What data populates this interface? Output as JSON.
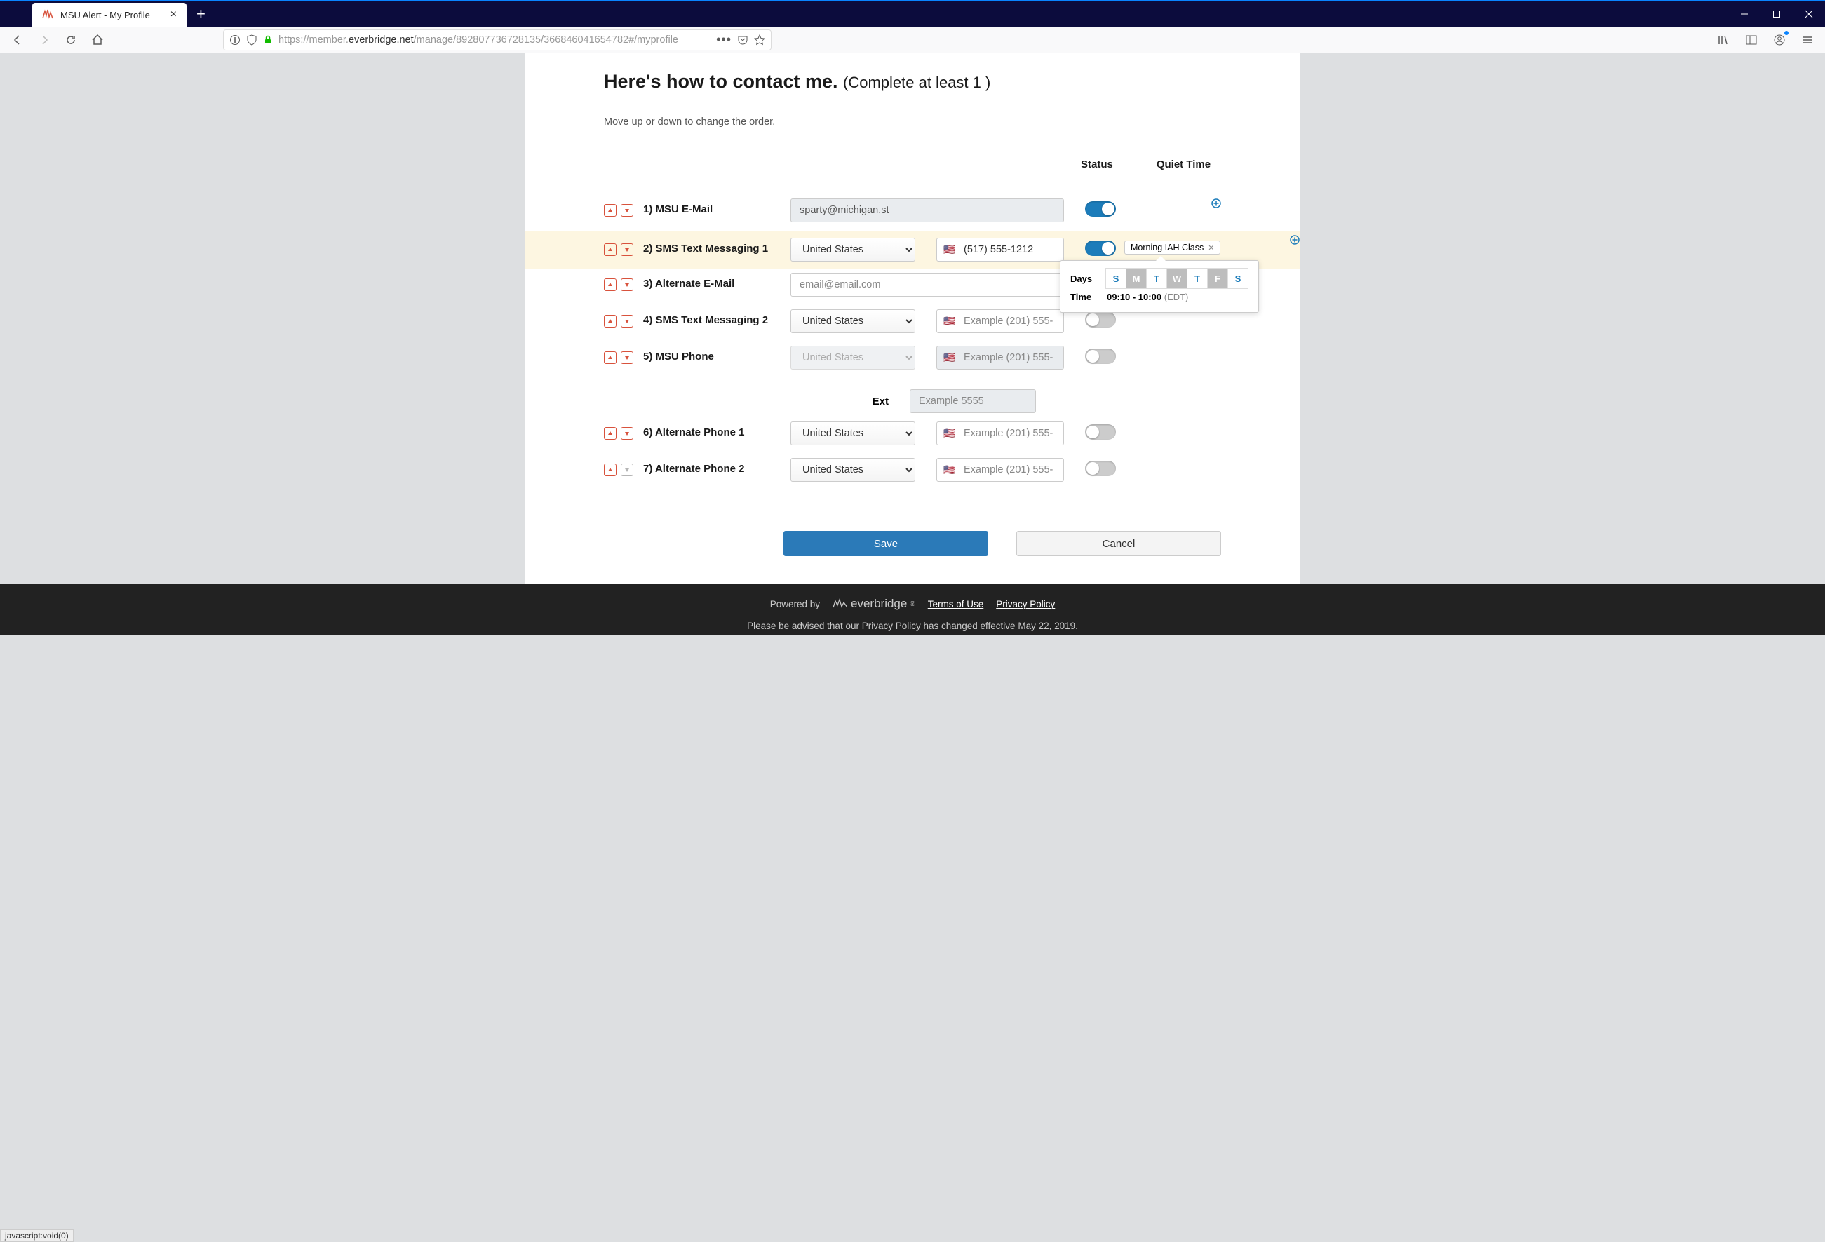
{
  "browser": {
    "tab_title": "MSU Alert - My Profile",
    "url_scheme": "https://",
    "url_rest_pre": "member.",
    "url_host": "everbridge.net",
    "url_rest_post": "/manage/892807736728135/366846041654782#/myprofile",
    "statusbar": "javascript:void(0)"
  },
  "page": {
    "heading_main": "Here's how to contact me. ",
    "heading_sub": "(Complete at least 1 )",
    "hint": "Move up or down to change the order.",
    "col_status": "Status",
    "col_quiet": "Quiet Time",
    "save": "Save",
    "cancel": "Cancel",
    "ext_label": "Ext",
    "ext_placeholder": "Example 5555"
  },
  "rows": {
    "r1": {
      "label": "1) MSU E-Mail",
      "value": "sparty@michigan.st",
      "status_on": true
    },
    "r2": {
      "label": "2) SMS Text Messaging 1",
      "country": "United States",
      "phone": "(517) 555-1212",
      "status_on": true
    },
    "r3": {
      "label": "3) Alternate E-Mail",
      "placeholder": "email@email.com"
    },
    "r4": {
      "label": "4) SMS Text Messaging 2",
      "country": "United States",
      "placeholder": "Example (201) 555-"
    },
    "r5": {
      "label": "5) MSU Phone",
      "country": "United States",
      "placeholder": "Example (201) 555-"
    },
    "r6": {
      "label": "6) Alternate Phone 1",
      "country": "United States",
      "placeholder": "Example (201) 555-"
    },
    "r7": {
      "label": "7) Alternate Phone 2",
      "country": "United States",
      "placeholder": "Example (201) 555-"
    }
  },
  "quiet_time": {
    "tag": "Morning IAH Class",
    "days_label": "Days",
    "time_label": "Time",
    "time_value": "09:10 - 10:00",
    "tz": "(EDT)",
    "days": [
      "S",
      "M",
      "T",
      "W",
      "T",
      "F",
      "S"
    ],
    "selected": [
      false,
      true,
      false,
      true,
      false,
      true,
      false
    ]
  },
  "footer": {
    "powered": "Powered by",
    "brand": "everbridge",
    "terms": "Terms of Use",
    "privacy": "Privacy Policy",
    "notice": "Please be advised that our Privacy Policy has changed effective May 22, 2019."
  }
}
